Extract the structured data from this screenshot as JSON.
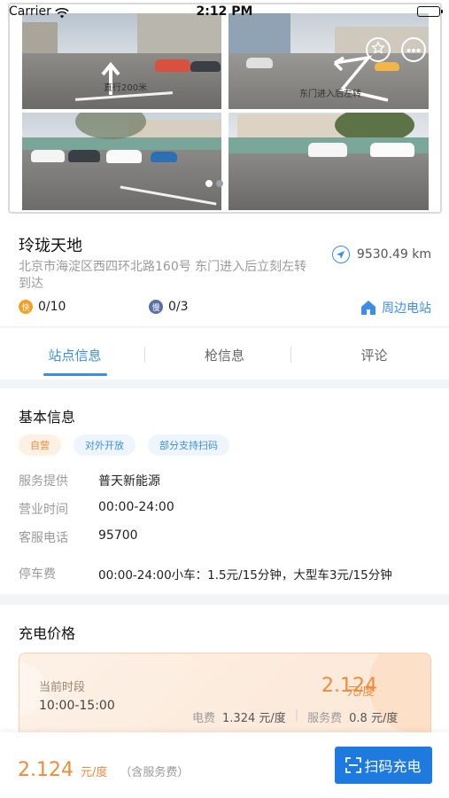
{
  "status_bar": {
    "carrier": "Carrier",
    "time": "2:12 PM",
    "icons": [
      "wifi-icon",
      "battery-icon"
    ]
  },
  "photos": {
    "captions": [
      "直行200米",
      "东门进入后左转"
    ],
    "header_icons": [
      "star-icon",
      "more-icon"
    ],
    "active_dot": 0,
    "dot_count": 2
  },
  "station": {
    "name": "玲珑天地",
    "address": "北京市海淀区西四环北路160号 东门进入后立刻左转到达",
    "distance": "9530.49 km",
    "fast": {
      "badge": "快",
      "count": "0/10"
    },
    "slow": {
      "badge": "慢",
      "count": "0/3"
    },
    "nearby_label": "周边电站"
  },
  "tabs": [
    {
      "label": "站点信息",
      "active": true
    },
    {
      "label": "枪信息",
      "active": false
    },
    {
      "label": "评论",
      "active": false
    }
  ],
  "basic_info": {
    "title": "基本信息",
    "tags": [
      "自营",
      "对外开放",
      "部分支持扫码"
    ],
    "rows": [
      {
        "key": "服务提供",
        "value": "普天新能源"
      },
      {
        "key": "营业时间",
        "value": "00:00-24:00"
      },
      {
        "key": "客服电话",
        "value": "95700"
      },
      {
        "key": "停车费",
        "value": "00:00-24:00小车：1.5元/15分钟，大型车3元/15分钟"
      }
    ]
  },
  "price": {
    "title": "充电价格",
    "period_label": "当前时段",
    "period": "10:00-15:00",
    "total": "2.124",
    "total_unit": "元/度",
    "elec_label": "电费",
    "elec_value": "1.324 元/度",
    "service_label": "服务费",
    "service_value": "0.8 元/度",
    "separator": "|"
  },
  "bottom": {
    "price": "2.124",
    "unit": "元/度",
    "note": "（含服务费）",
    "scan_label": "扫码充电"
  },
  "colors": {
    "accent": "#3b8ee6",
    "orange": "#f08a3c",
    "button": "#1f7ae0",
    "fast_badge": "#f4a024",
    "slow_badge": "#5b6fa8"
  }
}
